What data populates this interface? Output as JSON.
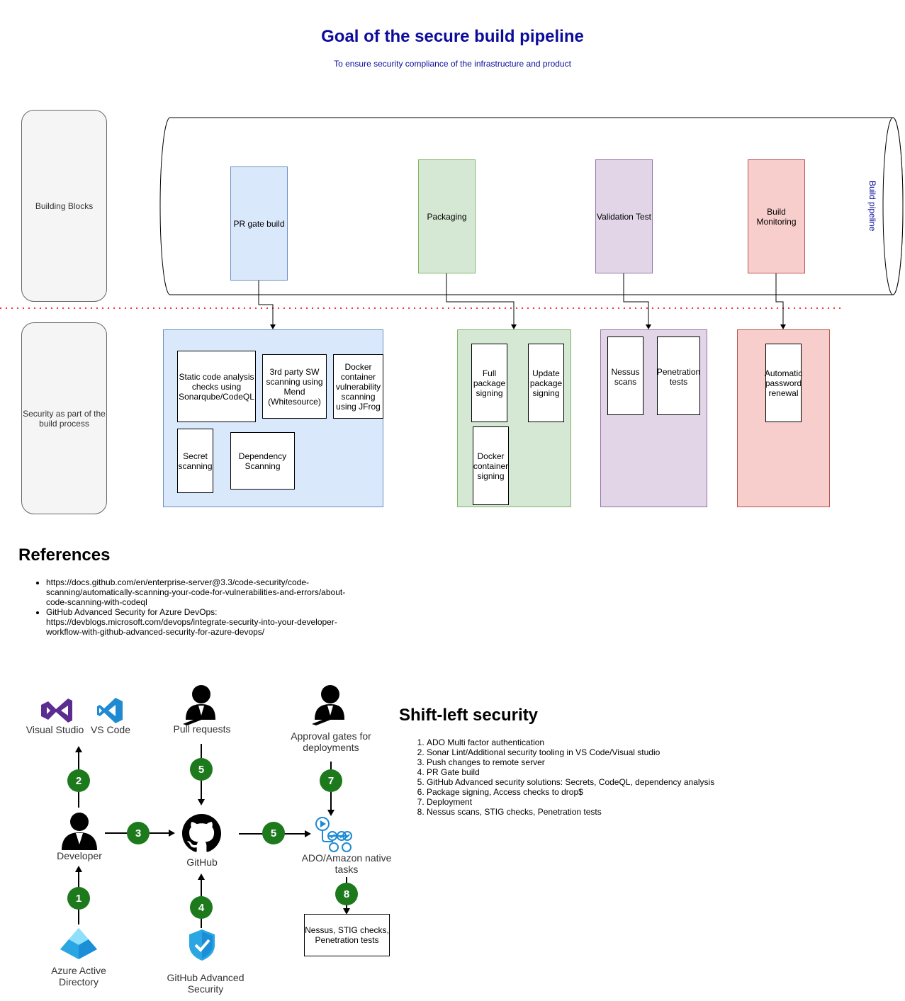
{
  "header": {
    "title": "Goal of the secure build pipeline",
    "subtitle": "To ensure security compliance of the infrastructure and product"
  },
  "lanes": {
    "building_blocks": "Building Blocks",
    "security": "Security as part of the build process"
  },
  "pipeline": {
    "label": "Build pipeline",
    "stages": [
      "PR gate build",
      "Packaging",
      "Validation Test",
      "Build Monitoring"
    ]
  },
  "security": {
    "pr_gate": [
      "Static code analysis checks using Sonarqube/CodeQL",
      "3rd party SW scanning using Mend (Whitesource)",
      "Docker container vulnerability scanning using JFrog",
      "Secret scanning",
      "Dependency Scanning"
    ],
    "packaging": [
      "Full package signing",
      "Update package signing",
      "Docker container signing"
    ],
    "validation": [
      "Nessus scans",
      "Penetration tests"
    ],
    "monitoring": [
      "Automatic password renewal"
    ]
  },
  "references": {
    "heading": "References",
    "items": [
      "https://docs.github.com/en/enterprise-server@3.3/code-security/code-scanning/automatically-scanning-your-code-for-vulnerabilities-and-errors/about-code-scanning-with-codeql",
      "GitHub Advanced Security for Azure DevOps: https://devblogs.microsoft.com/devops/integrate-security-into-your-developer-workflow-with-github-advanced-security-for-azure-devops/"
    ]
  },
  "flow": {
    "visual_studio": "Visual Studio",
    "vs_code": "VS Code",
    "pull_requests": "Pull requests",
    "approval": "Approval gates for deployments",
    "developer": "Developer",
    "github": "GitHub",
    "ado": "ADO/Amazon native tasks",
    "azure_ad": "Azure Active Directory",
    "ghas": "GitHub Advanced Security",
    "scans_box": "Nessus, STIG checks, Penetration tests",
    "step_numbers": [
      "2",
      "5",
      "7",
      "3",
      "5",
      "1",
      "4",
      "8"
    ]
  },
  "shift_left": {
    "heading": "Shift-left security",
    "steps": [
      "ADO Multi factor authentication",
      "Sonar Lint/Additional security tooling in VS Code/Visual studio",
      "Push changes to remote server",
      "PR Gate build",
      "GitHub Advanced security solutions: Secrets, CodeQL, dependency analysis",
      "Package signing, Access checks to drop$",
      "Deployment",
      "Nessus scans, STIG checks, Penetration tests"
    ]
  },
  "colors": {
    "title": "#0c0c9b",
    "blue_fill": "#dae8fc",
    "green_fill": "#d5e8d4",
    "purple_fill": "#e1d5e7",
    "red_fill": "#f8cecc",
    "step_circle": "#1c7a1c",
    "divider": "#ff3333"
  }
}
